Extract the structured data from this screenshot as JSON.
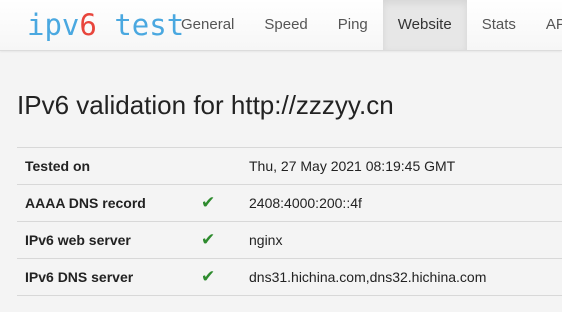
{
  "logo": {
    "part1": "ipv",
    "part2": "6",
    "part3": " test"
  },
  "nav": [
    {
      "label": "General",
      "active": false
    },
    {
      "label": "Speed",
      "active": false
    },
    {
      "label": "Ping",
      "active": false
    },
    {
      "label": "Website",
      "active": true
    },
    {
      "label": "Stats",
      "active": false
    },
    {
      "label": "API",
      "active": false
    }
  ],
  "page": {
    "title": "IPv6 validation for http://zzzyy.cn"
  },
  "results": [
    {
      "label": "Tested on",
      "check": "",
      "value": "Thu, 27 May 2021 08:19:45 GMT"
    },
    {
      "label": "AAAA DNS record",
      "check": "✔",
      "value": "2408:4000:200::4f"
    },
    {
      "label": "IPv6 web server",
      "check": "✔",
      "value": "nginx"
    },
    {
      "label": "IPv6 DNS server",
      "check": "✔",
      "value": "dns31.hichina.com,dns32.hichina.com"
    }
  ],
  "colors": {
    "logo_blue": "#4aa8e0",
    "logo_red": "#e8453c",
    "check_green": "#2e8b2e"
  },
  "icons": {
    "check": "checkmark-icon"
  }
}
